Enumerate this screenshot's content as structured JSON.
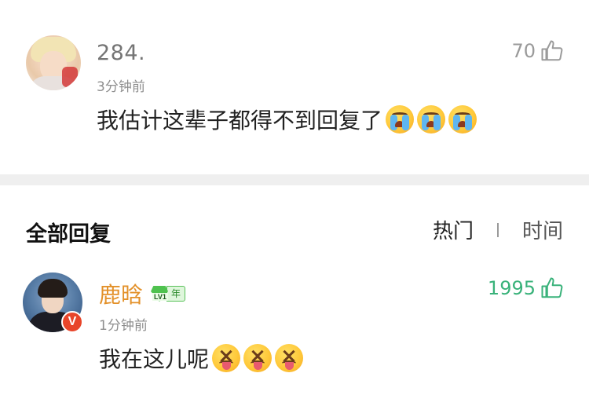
{
  "original_comment": {
    "username": "284.",
    "time": "3分钟前",
    "like_count": "70",
    "text": "我估计这辈子都得不到回复了",
    "emojis": [
      "loudly-crying-face",
      "loudly-crying-face",
      "loudly-crying-face"
    ]
  },
  "replies": {
    "header": "全部回复",
    "sort_options": [
      "热门",
      "时间"
    ],
    "items": [
      {
        "username": "鹿晗",
        "level_badge": "LV1",
        "badge_suffix": "年",
        "verified_badge": "V",
        "time": "1分钟前",
        "like_count": "1995",
        "text": "我在这儿呢",
        "emojis": [
          "squinting-tongue-face",
          "squinting-tongue-face",
          "squinting-tongue-face"
        ]
      }
    ]
  },
  "colors": {
    "username_verified": "#e3912a",
    "like_active": "#39b27a",
    "like_inactive": "#9a9a9a",
    "divider": "#efefef",
    "verified_badge": "#e8452a"
  }
}
